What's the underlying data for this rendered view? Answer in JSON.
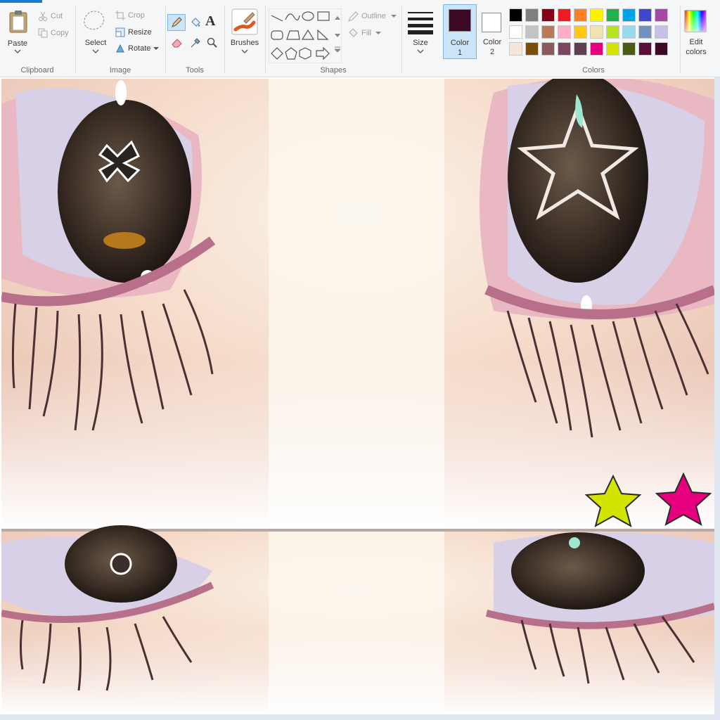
{
  "ribbon": {
    "clipboard": {
      "group_label": "Clipboard",
      "paste": "Paste",
      "cut": "Cut",
      "copy": "Copy"
    },
    "image": {
      "group_label": "Image",
      "select": "Select",
      "crop": "Crop",
      "resize": "Resize",
      "rotate": "Rotate"
    },
    "tools": {
      "group_label": "Tools",
      "text_tool": "A"
    },
    "brushes": {
      "label": "Brushes"
    },
    "shapes": {
      "group_label": "Shapes",
      "outline": "Outline",
      "fill": "Fill"
    },
    "size": {
      "label": "Size"
    },
    "color1": {
      "label": "Color",
      "num": "1",
      "color": "#3d0a25"
    },
    "color2": {
      "label": "Color",
      "num": "2",
      "color": "#ffffff"
    },
    "colors": {
      "group_label": "Colors",
      "palette_row1": [
        "#000000",
        "#7f7f7f",
        "#880015",
        "#ed1c24",
        "#ff7f27",
        "#fff200",
        "#22b14c",
        "#00a2e8",
        "#3f48cc",
        "#a349a4"
      ],
      "palette_row2": [
        "#ffffff",
        "#c3c3c3",
        "#b97a57",
        "#ffaec9",
        "#ffc90e",
        "#efe4b0",
        "#b5e61d",
        "#99d9ea",
        "#7092be",
        "#c8bfe7"
      ],
      "palette_row3": [
        "#f7e6d8",
        "#7a4e08",
        "#8c5a5a",
        "#7e4560",
        "#5f3f52",
        "#e6007e",
        "#d2e400",
        "#4b5b15",
        "#5a0e3a",
        "#3d0a25"
      ],
      "edit_label": "Edit",
      "edit_label2": "colors"
    }
  },
  "canvas": {
    "star_yellow_color": "#d2e400",
    "star_pink_color": "#e6007e"
  }
}
